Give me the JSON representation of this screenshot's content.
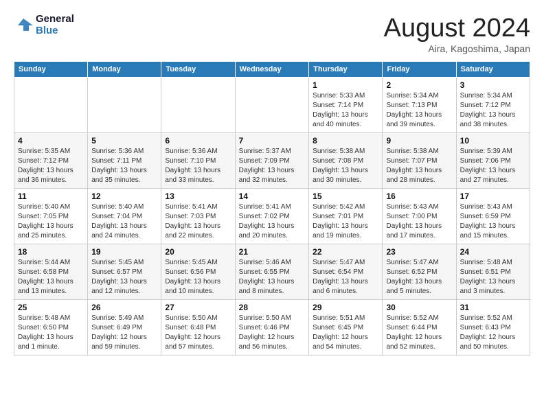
{
  "header": {
    "logo_line1": "General",
    "logo_line2": "Blue",
    "month": "August 2024",
    "location": "Aira, Kagoshima, Japan"
  },
  "weekdays": [
    "Sunday",
    "Monday",
    "Tuesday",
    "Wednesday",
    "Thursday",
    "Friday",
    "Saturday"
  ],
  "weeks": [
    [
      {
        "day": "",
        "info": ""
      },
      {
        "day": "",
        "info": ""
      },
      {
        "day": "",
        "info": ""
      },
      {
        "day": "",
        "info": ""
      },
      {
        "day": "1",
        "info": "Sunrise: 5:33 AM\nSunset: 7:14 PM\nDaylight: 13 hours\nand 40 minutes."
      },
      {
        "day": "2",
        "info": "Sunrise: 5:34 AM\nSunset: 7:13 PM\nDaylight: 13 hours\nand 39 minutes."
      },
      {
        "day": "3",
        "info": "Sunrise: 5:34 AM\nSunset: 7:12 PM\nDaylight: 13 hours\nand 38 minutes."
      }
    ],
    [
      {
        "day": "4",
        "info": "Sunrise: 5:35 AM\nSunset: 7:12 PM\nDaylight: 13 hours\nand 36 minutes."
      },
      {
        "day": "5",
        "info": "Sunrise: 5:36 AM\nSunset: 7:11 PM\nDaylight: 13 hours\nand 35 minutes."
      },
      {
        "day": "6",
        "info": "Sunrise: 5:36 AM\nSunset: 7:10 PM\nDaylight: 13 hours\nand 33 minutes."
      },
      {
        "day": "7",
        "info": "Sunrise: 5:37 AM\nSunset: 7:09 PM\nDaylight: 13 hours\nand 32 minutes."
      },
      {
        "day": "8",
        "info": "Sunrise: 5:38 AM\nSunset: 7:08 PM\nDaylight: 13 hours\nand 30 minutes."
      },
      {
        "day": "9",
        "info": "Sunrise: 5:38 AM\nSunset: 7:07 PM\nDaylight: 13 hours\nand 28 minutes."
      },
      {
        "day": "10",
        "info": "Sunrise: 5:39 AM\nSunset: 7:06 PM\nDaylight: 13 hours\nand 27 minutes."
      }
    ],
    [
      {
        "day": "11",
        "info": "Sunrise: 5:40 AM\nSunset: 7:05 PM\nDaylight: 13 hours\nand 25 minutes."
      },
      {
        "day": "12",
        "info": "Sunrise: 5:40 AM\nSunset: 7:04 PM\nDaylight: 13 hours\nand 24 minutes."
      },
      {
        "day": "13",
        "info": "Sunrise: 5:41 AM\nSunset: 7:03 PM\nDaylight: 13 hours\nand 22 minutes."
      },
      {
        "day": "14",
        "info": "Sunrise: 5:41 AM\nSunset: 7:02 PM\nDaylight: 13 hours\nand 20 minutes."
      },
      {
        "day": "15",
        "info": "Sunrise: 5:42 AM\nSunset: 7:01 PM\nDaylight: 13 hours\nand 19 minutes."
      },
      {
        "day": "16",
        "info": "Sunrise: 5:43 AM\nSunset: 7:00 PM\nDaylight: 13 hours\nand 17 minutes."
      },
      {
        "day": "17",
        "info": "Sunrise: 5:43 AM\nSunset: 6:59 PM\nDaylight: 13 hours\nand 15 minutes."
      }
    ],
    [
      {
        "day": "18",
        "info": "Sunrise: 5:44 AM\nSunset: 6:58 PM\nDaylight: 13 hours\nand 13 minutes."
      },
      {
        "day": "19",
        "info": "Sunrise: 5:45 AM\nSunset: 6:57 PM\nDaylight: 13 hours\nand 12 minutes."
      },
      {
        "day": "20",
        "info": "Sunrise: 5:45 AM\nSunset: 6:56 PM\nDaylight: 13 hours\nand 10 minutes."
      },
      {
        "day": "21",
        "info": "Sunrise: 5:46 AM\nSunset: 6:55 PM\nDaylight: 13 hours\nand 8 minutes."
      },
      {
        "day": "22",
        "info": "Sunrise: 5:47 AM\nSunset: 6:54 PM\nDaylight: 13 hours\nand 6 minutes."
      },
      {
        "day": "23",
        "info": "Sunrise: 5:47 AM\nSunset: 6:52 PM\nDaylight: 13 hours\nand 5 minutes."
      },
      {
        "day": "24",
        "info": "Sunrise: 5:48 AM\nSunset: 6:51 PM\nDaylight: 13 hours\nand 3 minutes."
      }
    ],
    [
      {
        "day": "25",
        "info": "Sunrise: 5:48 AM\nSunset: 6:50 PM\nDaylight: 13 hours\nand 1 minute."
      },
      {
        "day": "26",
        "info": "Sunrise: 5:49 AM\nSunset: 6:49 PM\nDaylight: 12 hours\nand 59 minutes."
      },
      {
        "day": "27",
        "info": "Sunrise: 5:50 AM\nSunset: 6:48 PM\nDaylight: 12 hours\nand 57 minutes."
      },
      {
        "day": "28",
        "info": "Sunrise: 5:50 AM\nSunset: 6:46 PM\nDaylight: 12 hours\nand 56 minutes."
      },
      {
        "day": "29",
        "info": "Sunrise: 5:51 AM\nSunset: 6:45 PM\nDaylight: 12 hours\nand 54 minutes."
      },
      {
        "day": "30",
        "info": "Sunrise: 5:52 AM\nSunset: 6:44 PM\nDaylight: 12 hours\nand 52 minutes."
      },
      {
        "day": "31",
        "info": "Sunrise: 5:52 AM\nSunset: 6:43 PM\nDaylight: 12 hours\nand 50 minutes."
      }
    ]
  ]
}
